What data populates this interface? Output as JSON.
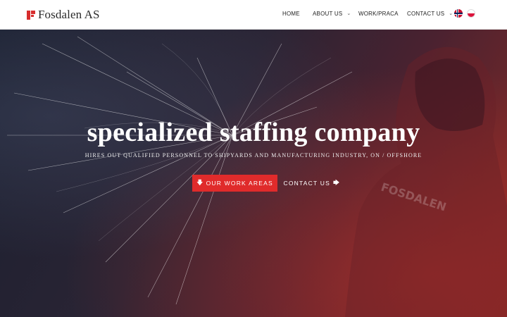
{
  "brand": {
    "name": "Fosdalen AS"
  },
  "nav": {
    "items": [
      {
        "label": "HOME",
        "has_dropdown": false
      },
      {
        "label": "ABOUT US",
        "has_dropdown": true
      },
      {
        "label": "WORK/PRACA",
        "has_dropdown": false
      },
      {
        "label": "CONTACT US",
        "has_dropdown": true
      }
    ],
    "languages": [
      "flag-norway-icon",
      "flag-poland-icon"
    ]
  },
  "hero": {
    "title": "specialized staffing company",
    "subtitle": "HIRES OUT QUALIFIED PERSONNEL TO SHIPYARDS AND MANUFACTURING INDUSTRY, ON / OFFSHORE",
    "primary_cta": {
      "label": "OUR WORK AREAS",
      "icon": "arrow-down-icon"
    },
    "secondary_cta": {
      "label": "CONTACT US",
      "icon": "arrow-right-icon"
    },
    "background_text": "FOSDALEN"
  },
  "colors": {
    "accent": "#e02b2b",
    "header_bg": "#ffffff",
    "hero_dark": "#1b2030",
    "hero_red": "#8a2a25"
  }
}
